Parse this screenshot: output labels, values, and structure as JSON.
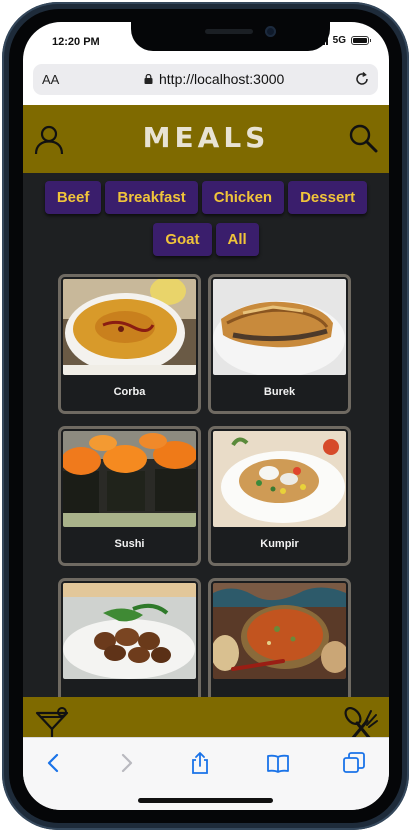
{
  "status_bar": {
    "time": "12:20 PM",
    "network": "5G"
  },
  "browser": {
    "text_size_label": "AA",
    "url": "http://localhost:3000"
  },
  "app": {
    "title": "MEALS",
    "categories": [
      "Beef",
      "Breakfast",
      "Chicken",
      "Dessert",
      "Goat",
      "All"
    ],
    "meals": [
      {
        "name": "Corba"
      },
      {
        "name": "Burek"
      },
      {
        "name": "Sushi"
      },
      {
        "name": "Kumpir"
      },
      {
        "name": ""
      },
      {
        "name": ""
      }
    ]
  },
  "icons": {
    "header_left": "user-icon",
    "header_right": "search-icon",
    "footer_left": "cocktail-icon",
    "footer_right": "utensils-icon"
  },
  "colors": {
    "header": "#7f6a00",
    "background": "#1e2022",
    "chip": "#3a1e6c",
    "chip_text": "#f0c43a"
  }
}
